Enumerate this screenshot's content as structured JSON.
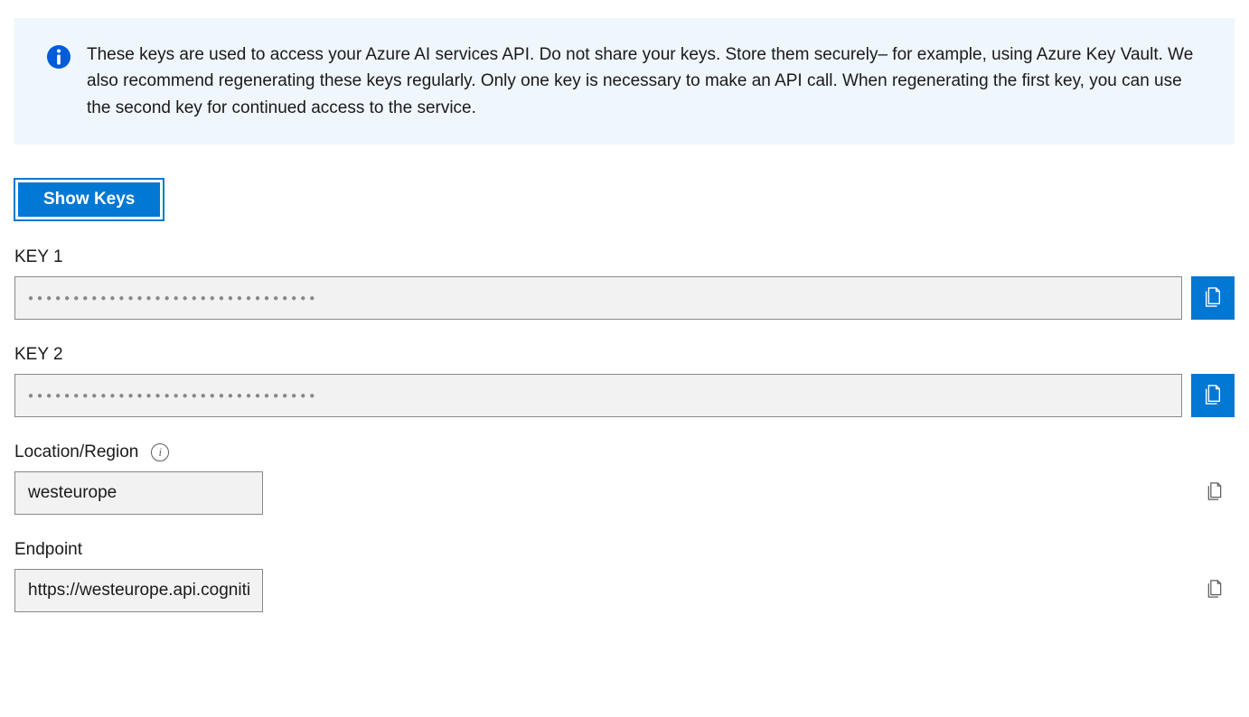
{
  "banner": {
    "text": "These keys are used to access your Azure AI services API. Do not share your keys. Store them securely– for example, using Azure Key Vault. We also recommend regenerating these keys regularly. Only one key is necessary to make an API call. When regenerating the first key, you can use the second key for continued access to the service."
  },
  "buttons": {
    "show_keys": "Show Keys"
  },
  "fields": {
    "key1": {
      "label": "KEY 1",
      "value": "●●●●●●●●●●●●●●●●●●●●●●●●●●●●●●●●"
    },
    "key2": {
      "label": "KEY 2",
      "value": "●●●●●●●●●●●●●●●●●●●●●●●●●●●●●●●●"
    },
    "location": {
      "label": "Location/Region",
      "value": "westeurope"
    },
    "endpoint": {
      "label": "Endpoint",
      "value": "https://westeurope.api.cognitive.microsoft.com/"
    }
  }
}
